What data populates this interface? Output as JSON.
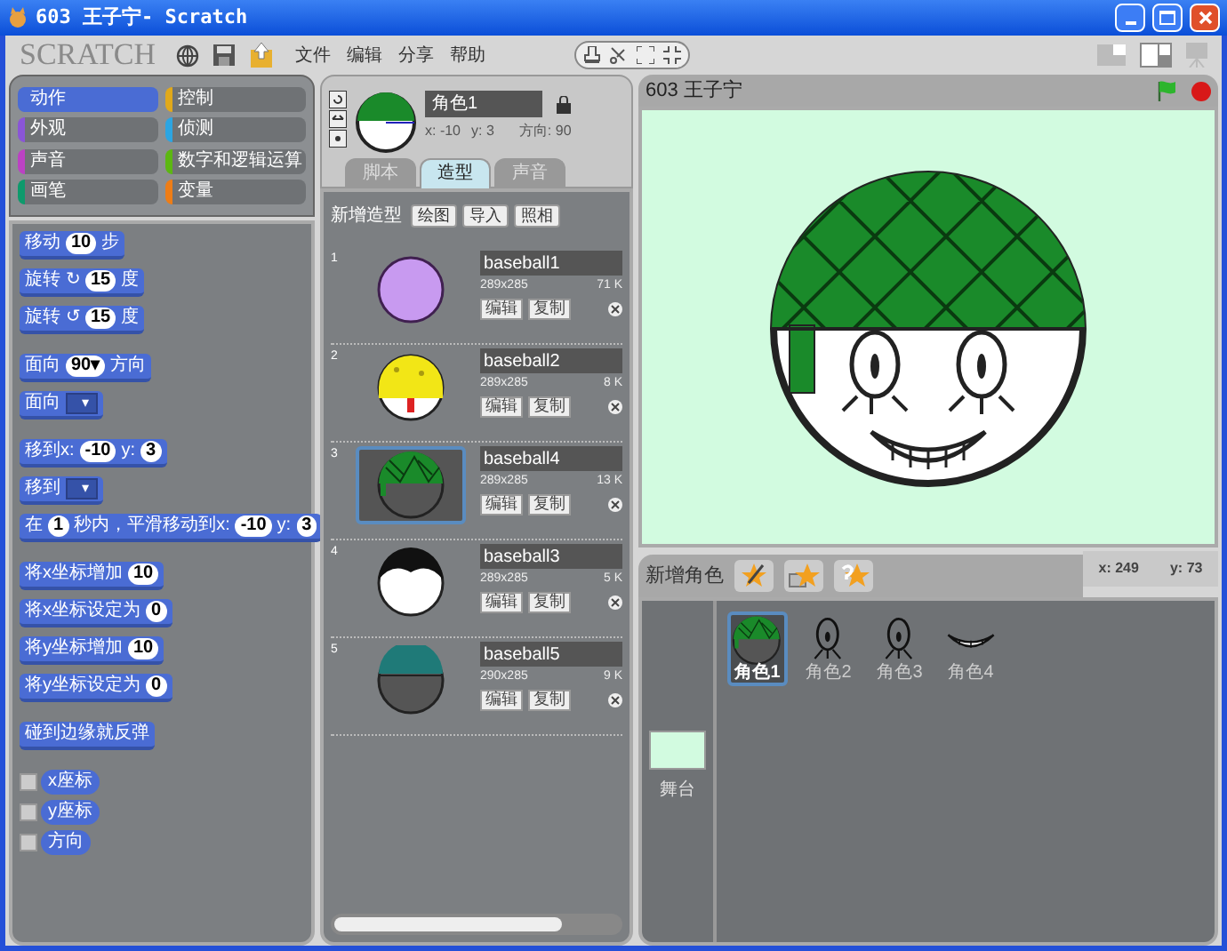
{
  "window": {
    "title": "603 王子宁- Scratch"
  },
  "logo": "SCRATCH",
  "menu": [
    "文件",
    "编辑",
    "分享",
    "帮助"
  ],
  "categories": [
    {
      "label": "动作",
      "color": "#4a6cd4",
      "selected": true
    },
    {
      "label": "控制",
      "color": "#e1a91a",
      "selected": false
    },
    {
      "label": "外观",
      "color": "#8a55d7",
      "selected": false
    },
    {
      "label": "侦测",
      "color": "#2ca5e2",
      "selected": false
    },
    {
      "label": "声音",
      "color": "#bb42c3",
      "selected": false
    },
    {
      "label": "数字和逻辑运算",
      "color": "#5cb712",
      "selected": false
    },
    {
      "label": "画笔",
      "color": "#0e9a6c",
      "selected": false
    },
    {
      "label": "变量",
      "color": "#ee7d16",
      "selected": false
    }
  ],
  "block_groups": [
    [
      {
        "parts": [
          {
            "kind": "label",
            "text": "移动"
          },
          {
            "kind": "number",
            "text": "10"
          },
          {
            "kind": "label",
            "text": "步"
          }
        ]
      },
      {
        "parts": [
          {
            "kind": "label",
            "text": "旋转"
          },
          {
            "kind": "label",
            "text": "↻"
          },
          {
            "kind": "number",
            "text": "15"
          },
          {
            "kind": "label",
            "text": "度"
          }
        ]
      },
      {
        "parts": [
          {
            "kind": "label",
            "text": "旋转"
          },
          {
            "kind": "label",
            "text": "↺"
          },
          {
            "kind": "number",
            "text": "15"
          },
          {
            "kind": "label",
            "text": "度"
          }
        ]
      }
    ],
    [
      {
        "parts": [
          {
            "kind": "label",
            "text": "面向"
          },
          {
            "kind": "dropdown",
            "text": "90▾"
          },
          {
            "kind": "label",
            "text": "方向"
          }
        ]
      },
      {
        "parts": [
          {
            "kind": "label",
            "text": "面向"
          },
          {
            "kind": "menu",
            "text": "▾"
          }
        ]
      }
    ],
    [
      {
        "parts": [
          {
            "kind": "label",
            "text": "移到x:"
          },
          {
            "kind": "number",
            "text": "-10"
          },
          {
            "kind": "label",
            "text": "y:"
          },
          {
            "kind": "number",
            "text": "3"
          }
        ]
      },
      {
        "parts": [
          {
            "kind": "label",
            "text": "移到"
          },
          {
            "kind": "menu",
            "text": "▾"
          }
        ]
      },
      {
        "parts": [
          {
            "kind": "label",
            "text": "在"
          },
          {
            "kind": "number",
            "text": "1"
          },
          {
            "kind": "label",
            "text": "秒内，平滑移动到x:"
          },
          {
            "kind": "number",
            "text": "-10"
          },
          {
            "kind": "label",
            "text": "y:"
          },
          {
            "kind": "number",
            "text": "3"
          }
        ]
      }
    ],
    [
      {
        "parts": [
          {
            "kind": "label",
            "text": "将x坐标增加"
          },
          {
            "kind": "number",
            "text": "10"
          }
        ]
      },
      {
        "parts": [
          {
            "kind": "label",
            "text": "将x坐标设定为"
          },
          {
            "kind": "number",
            "text": "0"
          }
        ]
      },
      {
        "parts": [
          {
            "kind": "label",
            "text": "将y坐标增加"
          },
          {
            "kind": "number",
            "text": "10"
          }
        ]
      },
      {
        "parts": [
          {
            "kind": "label",
            "text": "将y坐标设定为"
          },
          {
            "kind": "number",
            "text": "0"
          }
        ]
      }
    ],
    [
      {
        "parts": [
          {
            "kind": "label",
            "text": "碰到边缘就反弹"
          }
        ]
      }
    ]
  ],
  "watchers": [
    {
      "label": "x座标",
      "checked": false
    },
    {
      "label": "y座标",
      "checked": false
    },
    {
      "label": "方向",
      "checked": false
    }
  ],
  "sprite_info": {
    "name": "角色1",
    "x": "x: -10",
    "y": "y: 3",
    "direction": "方向: 90"
  },
  "tabs": [
    {
      "label": "脚本",
      "selected": false
    },
    {
      "label": "造型",
      "selected": true
    },
    {
      "label": "声音",
      "selected": false
    }
  ],
  "costumes": {
    "label": "新增造型",
    "buttons": [
      "绘图",
      "导入",
      "照相"
    ],
    "items": [
      {
        "number": "1",
        "name": "baseball1",
        "size": "289x285",
        "filesize": "71 K",
        "edit": "编辑",
        "copy": "复制",
        "kind": "ball",
        "selected": false
      },
      {
        "number": "2",
        "name": "baseball2",
        "size": "289x285",
        "filesize": "8 K",
        "edit": "编辑",
        "copy": "复制",
        "kind": "sponge",
        "selected": false
      },
      {
        "number": "3",
        "name": "baseball4",
        "size": "289x285",
        "filesize": "13 K",
        "edit": "编辑",
        "copy": "复制",
        "kind": "helmet",
        "selected": true
      },
      {
        "number": "4",
        "name": "baseball3",
        "size": "289x285",
        "filesize": "5 K",
        "edit": "编辑",
        "copy": "复制",
        "kind": "hair",
        "selected": false
      },
      {
        "number": "5",
        "name": "baseball5",
        "size": "290x285",
        "filesize": "9 K",
        "edit": "编辑",
        "copy": "复制",
        "kind": "cap",
        "selected": false
      }
    ]
  },
  "stage": {
    "title": "603 王子宁",
    "mouse_x": "x: 249",
    "mouse_y": "y: 73"
  },
  "sprites": {
    "label": "新增角色",
    "stage_label": "舞台",
    "items": [
      {
        "name": "角色1",
        "kind": "helmet",
        "selected": true
      },
      {
        "name": "角色2",
        "kind": "eye",
        "selected": false
      },
      {
        "name": "角色3",
        "kind": "eye",
        "selected": false
      },
      {
        "name": "角色4",
        "kind": "mouth",
        "selected": false
      }
    ]
  }
}
